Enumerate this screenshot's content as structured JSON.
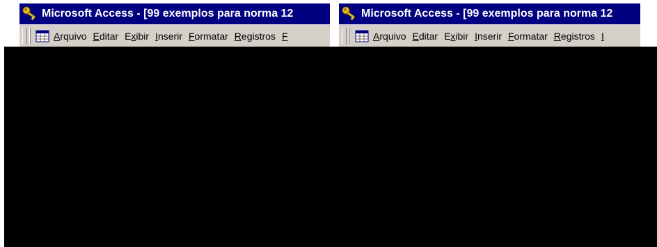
{
  "windows": [
    {
      "title": "Microsoft Access - [99 exemplos para norma 12",
      "menu": [
        {
          "pre": "",
          "acc": "A",
          "post": "rquivo"
        },
        {
          "pre": "",
          "acc": "E",
          "post": "ditar"
        },
        {
          "pre": "E",
          "acc": "x",
          "post": "ibir"
        },
        {
          "pre": "",
          "acc": "I",
          "post": "nserir"
        },
        {
          "pre": "",
          "acc": "F",
          "post": "ormatar"
        },
        {
          "pre": "",
          "acc": "R",
          "post": "egistros"
        },
        {
          "pre": "",
          "acc": "F",
          "post": ""
        }
      ]
    },
    {
      "title": "Microsoft Access - [99 exemplos para norma 12",
      "menu": [
        {
          "pre": "",
          "acc": "A",
          "post": "rquivo"
        },
        {
          "pre": "",
          "acc": "E",
          "post": "ditar"
        },
        {
          "pre": "E",
          "acc": "x",
          "post": "ibir"
        },
        {
          "pre": "",
          "acc": "I",
          "post": "nserir"
        },
        {
          "pre": "",
          "acc": "F",
          "post": "ormatar"
        },
        {
          "pre": "",
          "acc": "R",
          "post": "egistros"
        },
        {
          "pre": "",
          "acc": "I",
          "post": ""
        }
      ]
    }
  ],
  "colors": {
    "title_bar": "#000080",
    "menu_bar": "#d4d0c8",
    "obscured_area": "#000000"
  },
  "icons": [
    "access-key-icon",
    "datasheet-icon"
  ]
}
